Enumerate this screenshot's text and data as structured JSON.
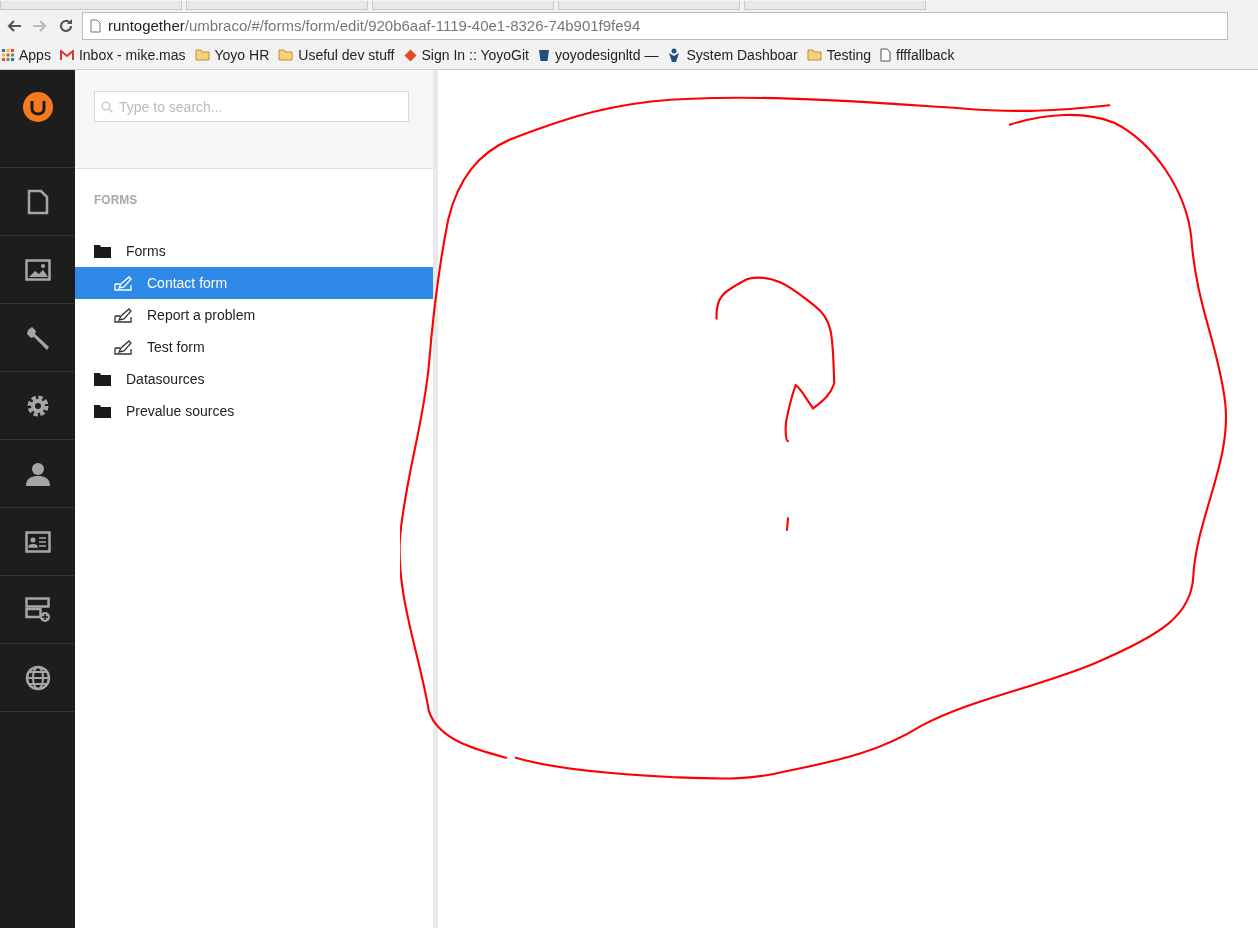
{
  "address_bar": {
    "host": "runtogether",
    "path": "/umbraco/#/forms/form/edit/920b6aaf-1119-40e1-8326-74b901f9fe94"
  },
  "bookmarks": [
    {
      "label": "Apps",
      "kind": "apps"
    },
    {
      "label": "Inbox - mike.mas",
      "kind": "mail"
    },
    {
      "label": "Yoyo HR",
      "kind": "folder"
    },
    {
      "label": "Useful dev stuff",
      "kind": "folder"
    },
    {
      "label": "Sign In :: YoyoGit",
      "kind": "git"
    },
    {
      "label": "yoyodesignltd —",
      "kind": "bucket"
    },
    {
      "label": "System Dashboar",
      "kind": "tool"
    },
    {
      "label": "Testing",
      "kind": "folder"
    },
    {
      "label": "ffffallback",
      "kind": "page"
    }
  ],
  "app_nav": [
    {
      "kind": "document"
    },
    {
      "kind": "image"
    },
    {
      "kind": "wrench"
    },
    {
      "kind": "gear"
    },
    {
      "kind": "person"
    },
    {
      "kind": "card"
    },
    {
      "kind": "server"
    },
    {
      "kind": "globe"
    }
  ],
  "search": {
    "placeholder": "Type to search..."
  },
  "tree": {
    "heading": "FORMS",
    "items": [
      {
        "label": "Forms",
        "kind": "folder",
        "selected": false,
        "children": [
          {
            "label": "Contact form",
            "kind": "form",
            "selected": true
          },
          {
            "label": "Report a problem",
            "kind": "form",
            "selected": false
          },
          {
            "label": "Test form",
            "kind": "form",
            "selected": false
          }
        ]
      },
      {
        "label": "Datasources",
        "kind": "folder",
        "selected": false
      },
      {
        "label": "Prevalue sources",
        "kind": "folder",
        "selected": false
      }
    ]
  }
}
